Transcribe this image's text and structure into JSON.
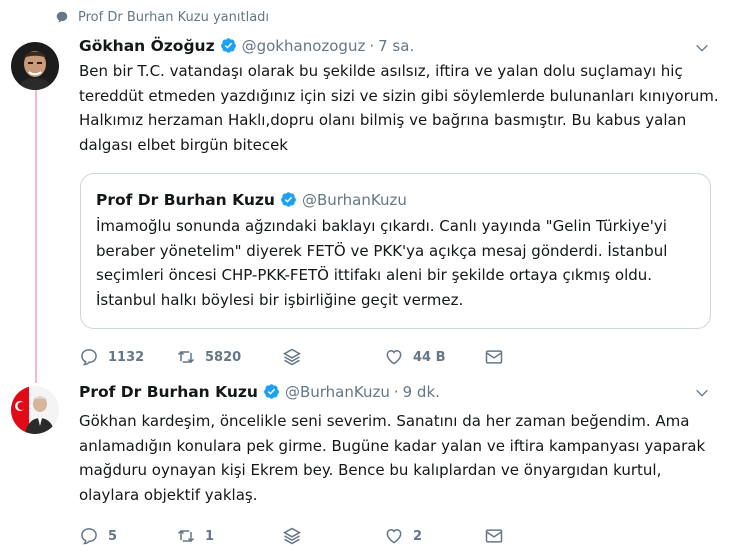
{
  "context": {
    "label": "Prof Dr Burhan Kuzu yanıtladı",
    "icon": "reply-context-icon"
  },
  "tweet1": {
    "name": "Gökhan Özoğuz",
    "handle": "@gokhanozoguz",
    "dot": "·",
    "time": "7 sa.",
    "text": "Ben bir T.C. vatandaşı olarak bu şekilde asılsız, iftira ve yalan dolu suçlamayı hiç tereddüt etmeden yazdığınız için sizi ve sizin gibi söylemlerde bulunanları kınıyorum. Halkımız herzaman Haklı,dopru olanı bilmiş ve bağrına basmıştır. Bu kabus yalan dalgası elbet birgün bitecek",
    "quote": {
      "name": "Prof Dr Burhan Kuzu",
      "handle": "@BurhanKuzu",
      "text": "İmamoğlu sonunda ağzındaki baklayı çıkardı. Canlı yayında \"Gelin Türkiye'yi beraber yönetelim\" diyerek FETÖ ve PKK'ya açıkça mesaj gönderdi. İstanbul seçimleri öncesi CHP-PKK-FETÖ ittifakı aleni bir şekilde ortaya çıkmış oldu. İstanbul halkı böylesi bir işbirliğine geçit vermez."
    },
    "stats": {
      "replies": "1132",
      "retweets": "5820",
      "likes": "44 B"
    }
  },
  "tweet2": {
    "name": "Prof Dr Burhan Kuzu",
    "handle": "@BurhanKuzu",
    "dot": "·",
    "time": "9 dk.",
    "text": "Gökhan kardeşim, öncelikle seni severim. Sanatını da her zaman beğendim. Ama anlamadığın konulara pek girme. Bugüne kadar yalan ve iftira kampanyası yaparak mağduru oynayan kişi Ekrem bey. Bence bu kalıplardan ve önyargıdan kurtul, olaylara objektif yaklaş.",
    "stats": {
      "replies": "5",
      "retweets": "1",
      "likes": "2"
    }
  },
  "colors": {
    "verified": "#1da1f2",
    "thread_line": "#f7b5cf",
    "secondary_text": "#657786",
    "border": "#ccd6dd"
  }
}
